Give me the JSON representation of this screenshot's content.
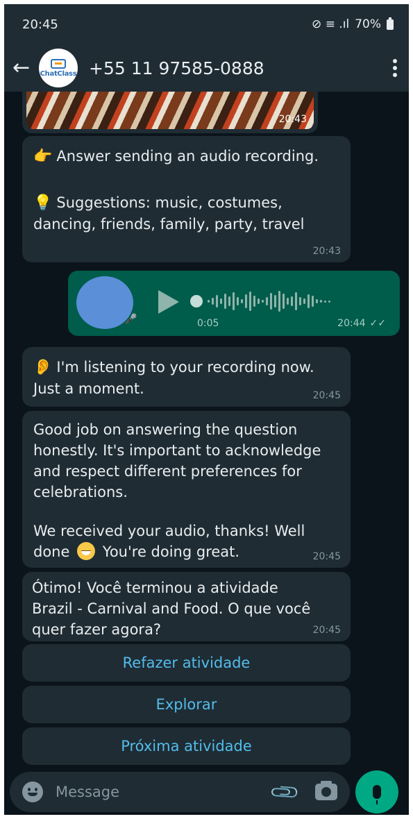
{
  "status_bar": {
    "time": "20:45",
    "battery": "70%",
    "signal_text": "⊘ ≡ .ıl"
  },
  "header": {
    "back_glyph": "←",
    "avatar_text": "ChatClass",
    "contact_name": "+55 11 97585-0888"
  },
  "messages": [
    {
      "kind": "image",
      "time": "20:43"
    },
    {
      "kind": "text",
      "emoji1": "👉",
      "line1": "Answer sending an audio recording.",
      "emoji2": "💡",
      "line2": "Suggestions: music, costumes, dancing, friends, family, party, travel",
      "time": "20:43"
    },
    {
      "kind": "audio",
      "duration": "0:05",
      "time": "20:44",
      "ticks": "✓✓"
    },
    {
      "kind": "text",
      "emoji": "👂",
      "text": "I'm listening to your recording now. Just a moment.",
      "time": "20:45"
    },
    {
      "kind": "text",
      "para1": "Good job on answering the question honestly. It's important to acknowledge and respect different preferences for celebrations.",
      "para2_a": "We received your audio, thanks! Well done",
      "para2_b": "You're doing great.",
      "time": "20:45"
    },
    {
      "kind": "text",
      "text": "Ótimo! Você terminou a atividade Brazil - Carnival and Food. O que você quer fazer agora?",
      "time": "20:45"
    }
  ],
  "options": [
    "Refazer atividade",
    "Explorar",
    "Próxima atividade"
  ],
  "input": {
    "placeholder": "Message"
  },
  "icons": {
    "back": "arrow-left-icon",
    "more": "more-vertical-icon",
    "emoji": "emoji-icon",
    "attach": "paperclip-icon",
    "camera": "camera-icon",
    "mic": "mic-icon",
    "play": "play-icon"
  },
  "colors": {
    "background": "#0b141a",
    "incoming_bubble": "#1f2c34",
    "outgoing_bubble": "#005c4b",
    "accent": "#00a884",
    "link": "#53bdeb"
  }
}
